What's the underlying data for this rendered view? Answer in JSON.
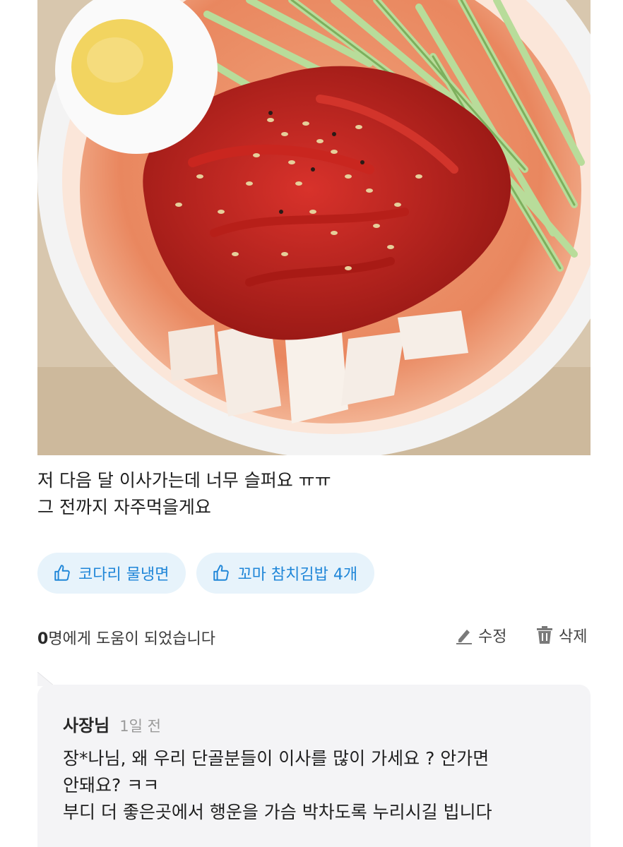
{
  "review": {
    "text": "저 다음 달 이사가는데 너무 슬퍼요 ㅠㅠ\n그 전까지 자주먹을게요"
  },
  "menus": [
    {
      "label": "코다리 물냉면",
      "icon": "thumbs-up-icon"
    },
    {
      "label": "꼬마 참치김밥 4개",
      "icon": "thumbs-up-icon"
    }
  ],
  "helpful": {
    "count": "0",
    "text": "명에게 도움이 되었습니다"
  },
  "actions": {
    "edit": {
      "label": "수정",
      "icon": "pencil-icon"
    },
    "delete": {
      "label": "삭제",
      "icon": "trash-icon"
    }
  },
  "owner_reply": {
    "author": "사장님",
    "time": "1일 전",
    "text": "장*나님, 왜 우리 단골분들이 이사를 많이 가세요 ? 안가면\n안돼요? ㅋㅋ\n부디 더 좋은곳에서 행운을 가슴 박차도록 누리시길 빕니다"
  },
  "colors": {
    "accent": "#1f86d8",
    "chip_bg": "#e7f3fb",
    "reply_bg": "#f4f4f6"
  }
}
